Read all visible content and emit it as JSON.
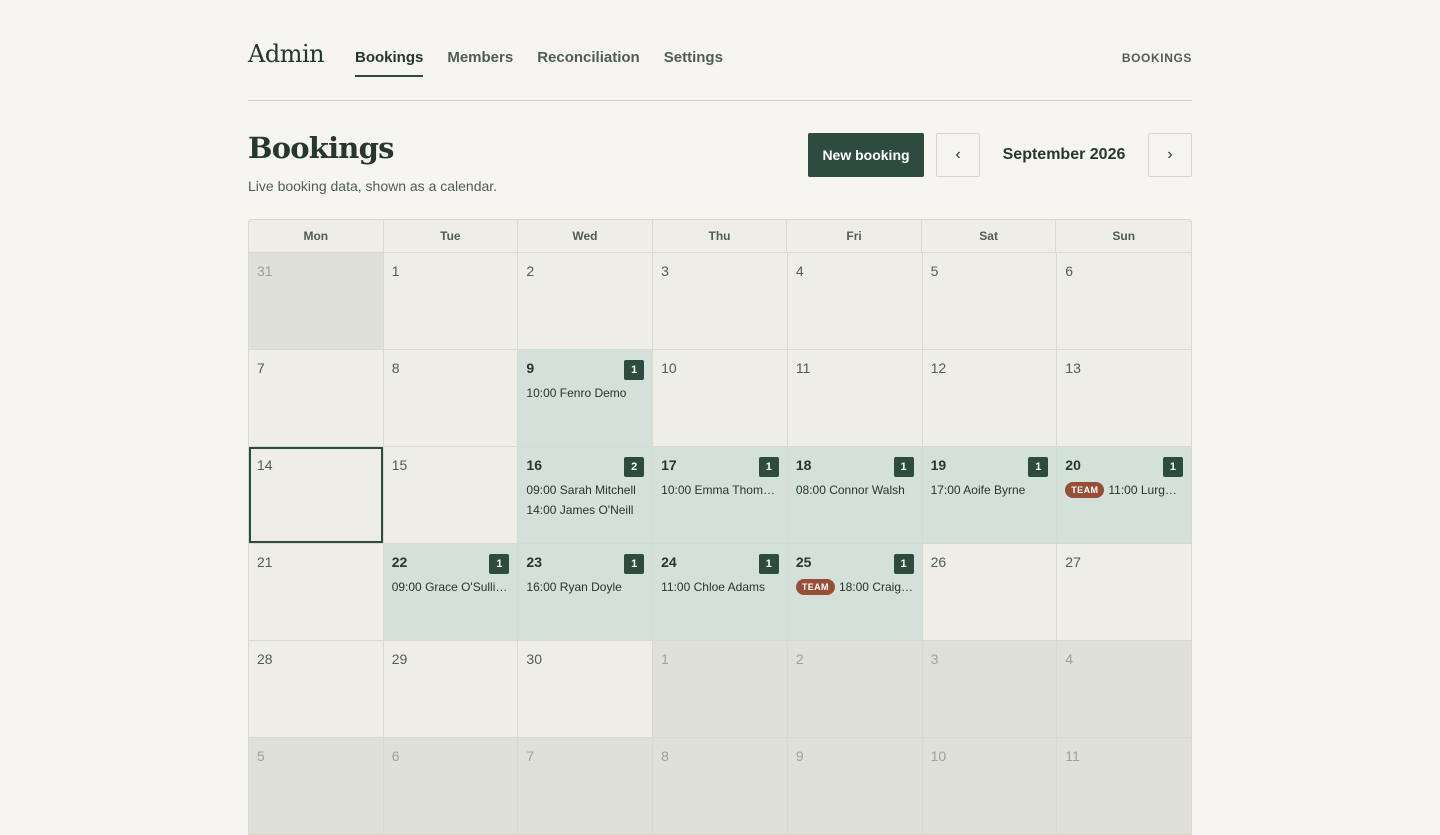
{
  "brand": "Admin",
  "nav": {
    "items": [
      {
        "label": "Bookings",
        "active": true
      },
      {
        "label": "Members",
        "active": false
      },
      {
        "label": "Reconciliation",
        "active": false
      },
      {
        "label": "Settings",
        "active": false
      }
    ],
    "right_label": "BOOKINGS"
  },
  "header": {
    "title": "Bookings",
    "subtitle": "Live booking data, shown as a calendar.",
    "new_button": "New booking",
    "prev_icon": "‹",
    "next_icon": "›",
    "month": "September 2026"
  },
  "calendar": {
    "weekdays": [
      "Mon",
      "Tue",
      "Wed",
      "Thu",
      "Fri",
      "Sat",
      "Sun"
    ],
    "days": [
      {
        "day": "31",
        "outside": true
      },
      {
        "day": "1"
      },
      {
        "day": "2"
      },
      {
        "day": "3"
      },
      {
        "day": "4"
      },
      {
        "day": "5"
      },
      {
        "day": "6"
      },
      {
        "day": "7"
      },
      {
        "day": "8"
      },
      {
        "day": "9",
        "count": "1",
        "events": [
          {
            "text": "10:00 Fenro Demo"
          }
        ]
      },
      {
        "day": "10"
      },
      {
        "day": "11"
      },
      {
        "day": "12"
      },
      {
        "day": "13"
      },
      {
        "day": "14",
        "today": true
      },
      {
        "day": "15"
      },
      {
        "day": "16",
        "count": "2",
        "events": [
          {
            "text": "09:00 Sarah Mitchell"
          },
          {
            "text": "14:00 James O'Neill"
          }
        ]
      },
      {
        "day": "17",
        "count": "1",
        "events": [
          {
            "text": "10:00 Emma Thom…"
          }
        ]
      },
      {
        "day": "18",
        "count": "1",
        "events": [
          {
            "text": "08:00 Connor Walsh"
          }
        ]
      },
      {
        "day": "19",
        "count": "1",
        "events": [
          {
            "text": "17:00 Aoife Byrne"
          }
        ]
      },
      {
        "day": "20",
        "count": "1",
        "events": [
          {
            "tag": "TEAM",
            "text": "11:00 Lurg…"
          }
        ]
      },
      {
        "day": "21"
      },
      {
        "day": "22",
        "count": "1",
        "events": [
          {
            "text": "09:00 Grace O'Sulli…"
          }
        ]
      },
      {
        "day": "23",
        "count": "1",
        "events": [
          {
            "text": "16:00 Ryan Doyle"
          }
        ]
      },
      {
        "day": "24",
        "count": "1",
        "events": [
          {
            "text": "11:00 Chloe Adams"
          }
        ]
      },
      {
        "day": "25",
        "count": "1",
        "events": [
          {
            "tag": "TEAM",
            "text": "18:00 Craig…"
          }
        ]
      },
      {
        "day": "26"
      },
      {
        "day": "27"
      },
      {
        "day": "28"
      },
      {
        "day": "29"
      },
      {
        "day": "30"
      },
      {
        "day": "1",
        "outside": true
      },
      {
        "day": "2",
        "outside": true
      },
      {
        "day": "3",
        "outside": true
      },
      {
        "day": "4",
        "outside": true
      },
      {
        "day": "5",
        "outside": true
      },
      {
        "day": "6",
        "outside": true
      },
      {
        "day": "7",
        "outside": true
      },
      {
        "day": "8",
        "outside": true
      },
      {
        "day": "9",
        "outside": true
      },
      {
        "day": "10",
        "outside": true
      },
      {
        "day": "11",
        "outside": true
      }
    ]
  }
}
